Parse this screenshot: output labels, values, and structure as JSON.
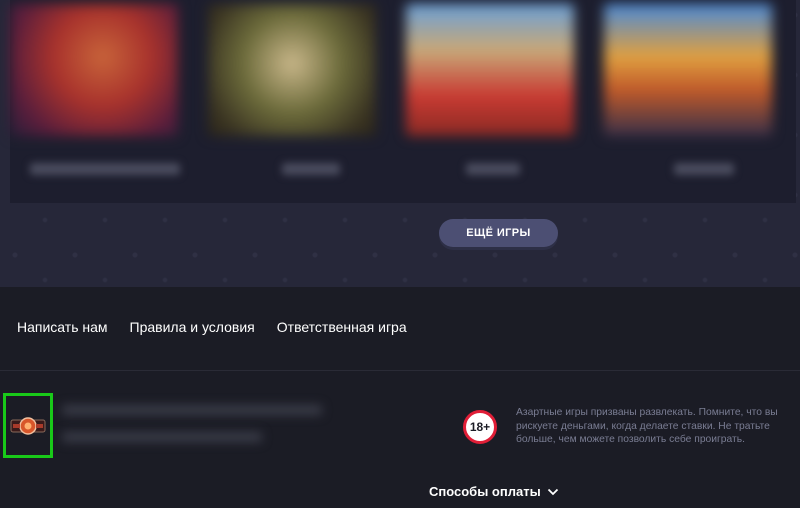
{
  "games": {
    "more_button_label": "ЕЩЁ ИГРЫ"
  },
  "footer": {
    "links": [
      {
        "label": "Написать нам"
      },
      {
        "label": "Правила и условия"
      },
      {
        "label": "Ответственная игра"
      }
    ],
    "age_badge": "18+",
    "disclaimer": "Азартные игры призваны развлекать. Помните, что вы рискуете деньгами, когда делаете ставки. Не тратьте больше, чем можете позволить себе проиграть.",
    "payment_methods_label": "Способы оплаты"
  },
  "icons": {
    "logo": "casino-logo-icon",
    "payment_toggle": "chevron-down-icon"
  },
  "colors": {
    "age_badge_ring": "#e01e37",
    "highlight_box": "#19c919",
    "more_button": "#4c4f73"
  }
}
